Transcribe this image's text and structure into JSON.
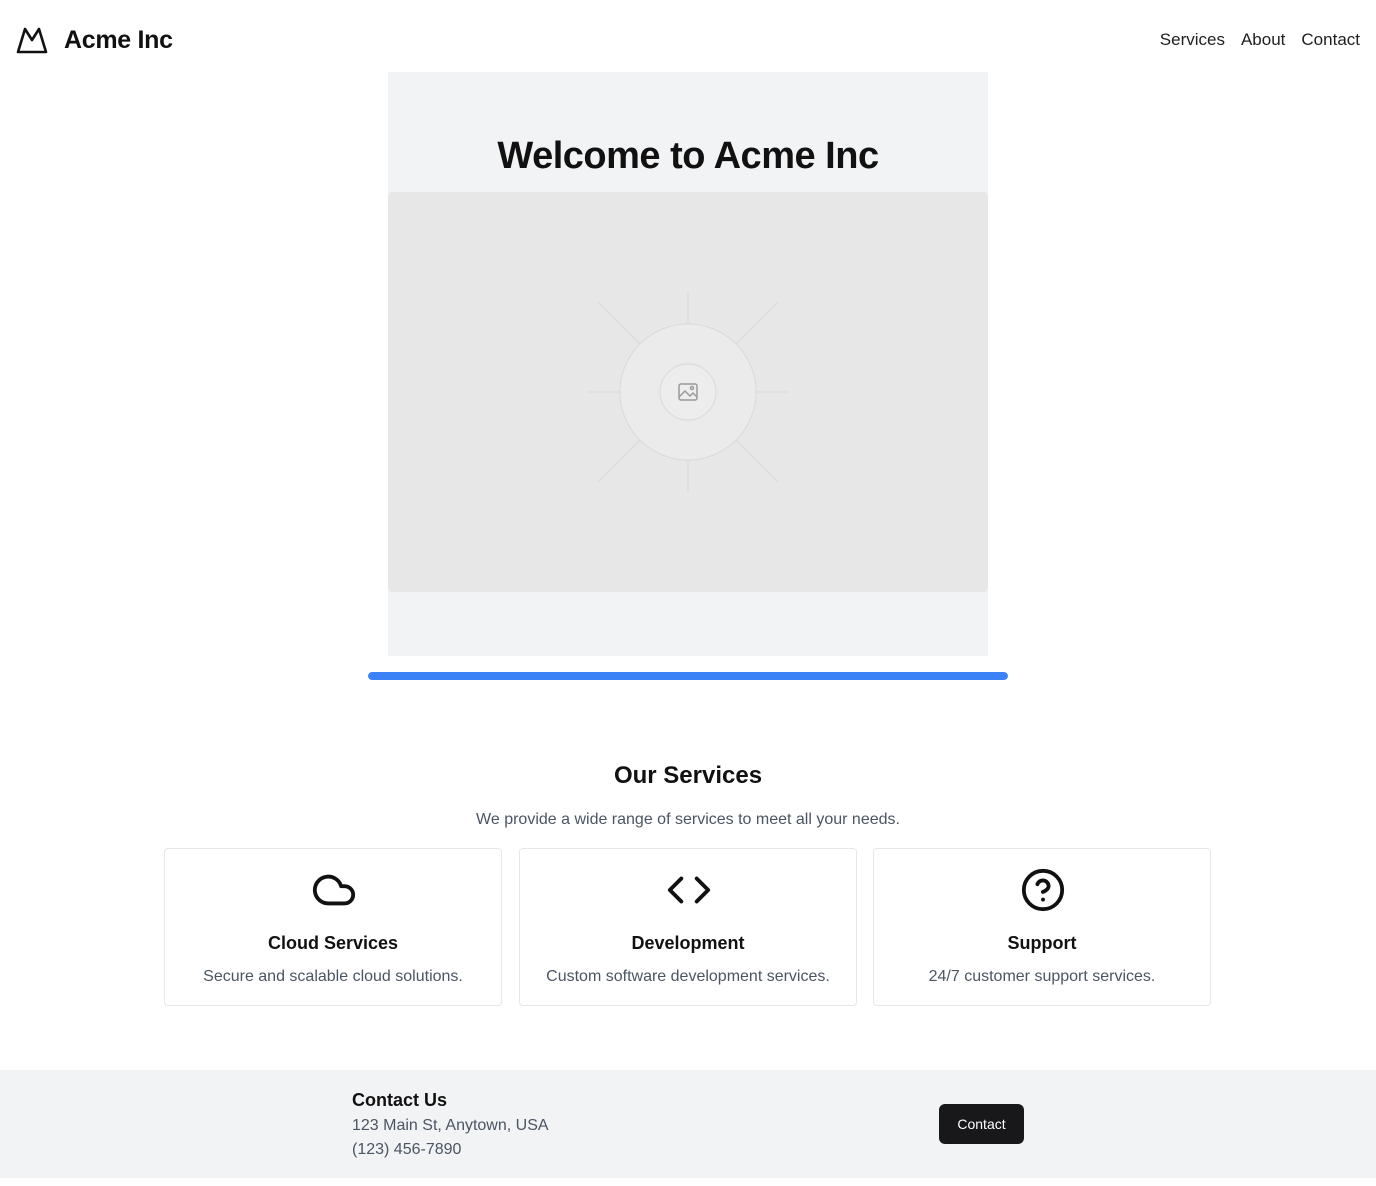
{
  "header": {
    "logo_icon": "mountain-icon",
    "brand": "Acme Inc",
    "nav": [
      {
        "label": "Services"
      },
      {
        "label": "About"
      },
      {
        "label": "Contact"
      }
    ]
  },
  "hero": {
    "title": "Welcome to Acme Inc",
    "image_icon": "image-placeholder-icon",
    "progress": 1.0,
    "progress_color": "#3b82f6"
  },
  "services": {
    "title": "Our Services",
    "subtitle": "We provide a wide range of services to meet all your needs.",
    "items": [
      {
        "icon": "cloud-icon",
        "title": "Cloud Services",
        "description": "Secure and scalable cloud solutions."
      },
      {
        "icon": "code-icon",
        "title": "Development",
        "description": "Custom software development services."
      },
      {
        "icon": "help-circle-icon",
        "title": "Support",
        "description": "24/7 customer support services."
      }
    ]
  },
  "footer": {
    "title": "Contact Us",
    "address": "123 Main St, Anytown, USA",
    "phone": "(123) 456-7890",
    "button_label": "Contact"
  }
}
